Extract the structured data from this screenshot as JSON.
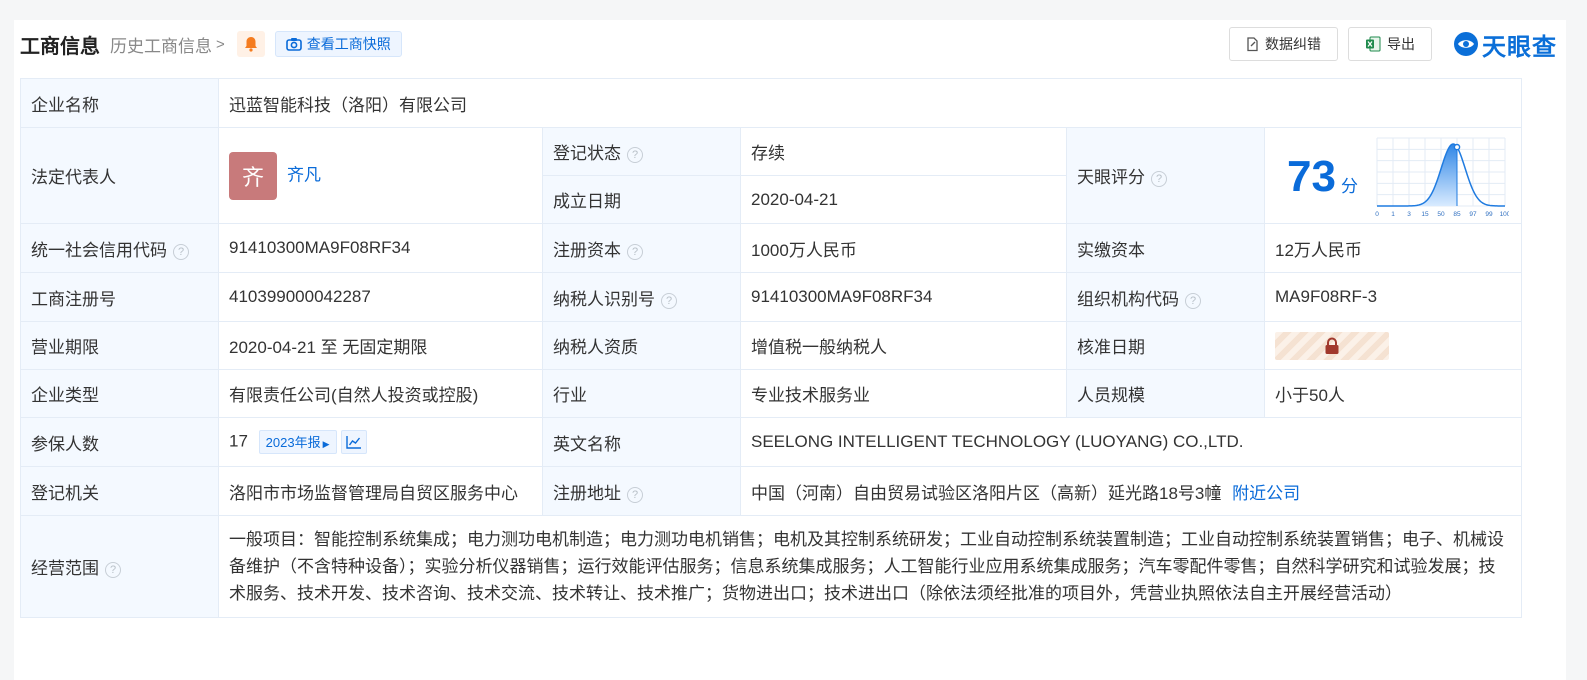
{
  "header": {
    "title": "工商信息",
    "history_link": "历史工商信息",
    "snapshot_button": "查看工商快照",
    "data_correction_button": "数据纠错",
    "export_button": "导出",
    "logo_text": "天眼查"
  },
  "labels": {
    "company_name": "企业名称",
    "legal_rep": "法定代表人",
    "reg_status": "登记状态",
    "founded": "成立日期",
    "tianyan_score": "天眼评分",
    "credit_code": "统一社会信用代码",
    "reg_capital": "注册资本",
    "paid_capital": "实缴资本",
    "reg_number": "工商注册号",
    "taxpayer_id": "纳税人识别号",
    "org_code": "组织机构代码",
    "business_term": "营业期限",
    "taxpayer_qual": "纳税人资质",
    "approval_date": "核准日期",
    "company_type": "企业类型",
    "industry": "行业",
    "staff_size": "人员规模",
    "insured": "参保人数",
    "english_name": "英文名称",
    "reg_authority": "登记机关",
    "reg_address": "注册地址",
    "business_scope": "经营范围"
  },
  "values": {
    "company_name": "迅蓝智能科技（洛阳）有限公司",
    "legal_rep_avatar": "齐",
    "legal_rep": "齐凡",
    "reg_status": "存续",
    "founded": "2020-04-21",
    "score": "73",
    "score_unit": "分",
    "credit_code": "91410300MA9F08RF34",
    "reg_capital": "1000万人民币",
    "paid_capital": "12万人民币",
    "reg_number": "410399000042287",
    "taxpayer_id": "91410300MA9F08RF34",
    "org_code": "MA9F08RF-3",
    "business_term": "2020-04-21 至 无固定期限",
    "taxpayer_qual": "增值税一般纳税人",
    "company_type": "有限责任公司(自然人投资或控股)",
    "industry": "专业技术服务业",
    "staff_size": "小于50人",
    "insured": "17",
    "insured_report": "2023年报",
    "english_name": "SEELONG INTELLIGENT TECHNOLOGY (LUOYANG) CO.,LTD.",
    "reg_authority": "洛阳市市场监督管理局自贸区服务中心",
    "reg_address": "中国（河南）自由贸易试验区洛阳片区（高新）延光路18号3幢",
    "nearby_link": "附近公司",
    "business_scope": "一般项目：智能控制系统集成；电力测功电机制造；电力测功电机销售；电机及其控制系统研发；工业自动控制系统装置制造；工业自动控制系统装置销售；电子、机械设备维护（不含特种设备）；实验分析仪器销售；运行效能评估服务；信息系统集成服务；人工智能行业应用系统集成服务；汽车零配件零售；自然科学研究和试验发展；技术服务、技术开发、技术咨询、技术交流、技术转让、技术推广；货物进出口；技术进出口（除依法须经批准的项目外，凭营业执照依法自主开展经营活动）"
  },
  "score_chart": {
    "ticks": [
      "0",
      "1",
      "3",
      "15",
      "50",
      "85",
      "97",
      "99",
      "100"
    ],
    "score_tick_index": 5
  },
  "colors": {
    "accent": "#0a6bd9",
    "status_green": "#1e9d4a",
    "label_bg": "#f4f9ff",
    "avatar": "#c87a7b"
  },
  "icons": {
    "help": "?"
  }
}
